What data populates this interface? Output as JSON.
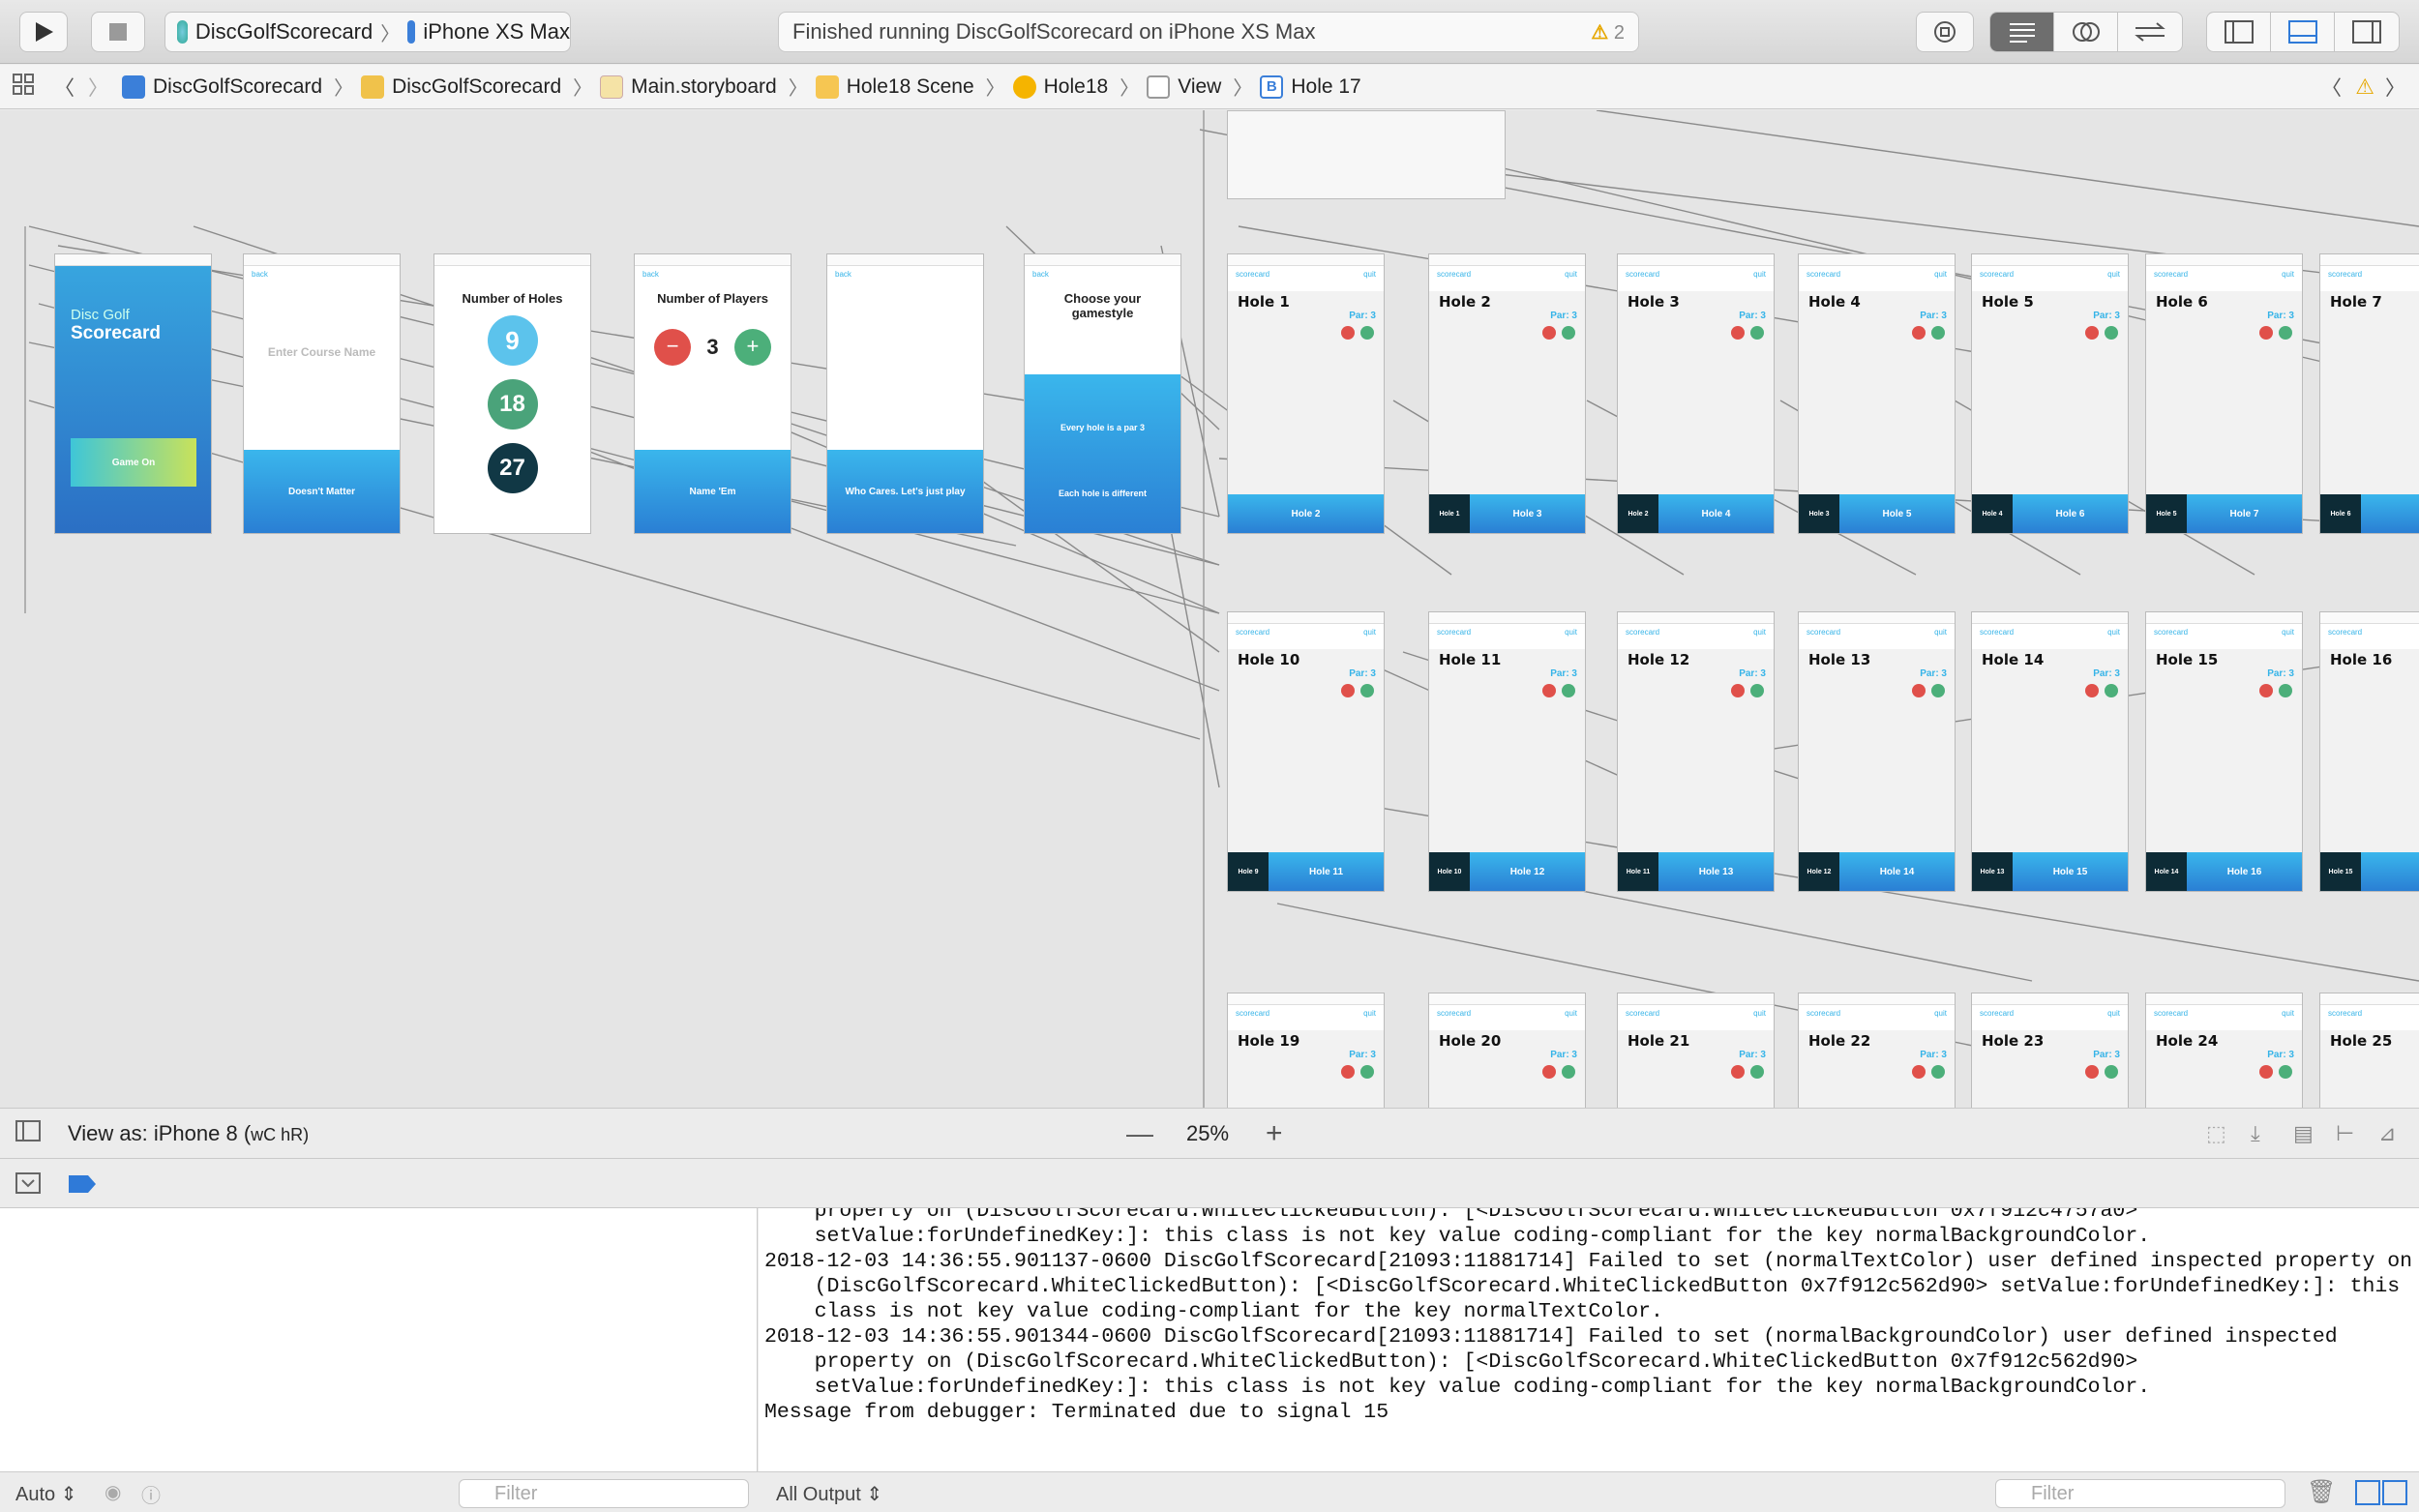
{
  "toolbar": {
    "scheme_target": "DiscGolfScorecard",
    "scheme_device": "iPhone XS Max",
    "activity_text": "Finished running DiscGolfScorecard on iPhone XS Max",
    "warning_count": "2"
  },
  "jumpbar": {
    "items": [
      "DiscGolfScorecard",
      "DiscGolfScorecard",
      "Main.storyboard",
      "Hole18 Scene",
      "Hole18",
      "View",
      "Hole 17"
    ]
  },
  "canvas": {
    "splash": {
      "title_top": "Disc Golf",
      "title_bottom": "Scorecard",
      "button": "Game On"
    },
    "course": {
      "placeholder": "Enter Course Name",
      "button": "Doesn't Matter"
    },
    "holes_scene": {
      "title": "Number of Holes",
      "options": [
        "9",
        "18",
        "27"
      ]
    },
    "players_scene": {
      "title": "Number of Players",
      "count": "3",
      "button": "Name 'Em"
    },
    "names_scene": {
      "button": "Who Cares. Let's just play"
    },
    "style_scene": {
      "title": "Choose your gamestyle",
      "option1": "Every hole is a par 3",
      "option2": "Each hole is different"
    },
    "hole_nav": {
      "back": "back",
      "scorecard": "scorecard",
      "quit": "quit",
      "par": "Par: 3"
    },
    "hole_titles": [
      "Hole 1",
      "Hole 2",
      "Hole 3",
      "Hole 4",
      "Hole 5",
      "Hole 6",
      "Hole 7",
      "Hole 10",
      "Hole 11",
      "Hole 12",
      "Hole 13",
      "Hole 14",
      "Hole 15",
      "Hole 16",
      "Hole 19",
      "Hole 20",
      "Hole 21",
      "Hole 22",
      "Hole 23",
      "Hole 24",
      "Hole 25"
    ],
    "row1_next": [
      "Hole 2",
      "Hole 3",
      "Hole 4",
      "Hole 5",
      "Hole 6",
      "Hole 7"
    ],
    "row1_prev": [
      "",
      "Hole 1",
      "Hole 2",
      "Hole 3",
      "Hole 4",
      "Hole 5",
      "Hole 6"
    ],
    "row2_next": [
      "Hole 11",
      "Hole 12",
      "Hole 13",
      "Hole 14",
      "Hole 15",
      "Hole 16"
    ],
    "row2_prev": [
      "Hole 9",
      "Hole 10",
      "Hole 11",
      "Hole 12",
      "Hole 13",
      "Hole 14",
      "Hole 15"
    ]
  },
  "canvasbar": {
    "view_as": "View as: iPhone 8 (",
    "size_class": "wC hR)",
    "zoom": "25%"
  },
  "console": {
    "lines": [
      "    property on (DiscGolfScorecard.WhiteClickedButton): [<DiscGolfScorecard.WhiteClickedButton 0x7f912c4757a0>",
      "    setValue:forUndefinedKey:]: this class is not key value coding-compliant for the key normalBackgroundColor.",
      "2018-12-03 14:36:55.901137-0600 DiscGolfScorecard[21093:11881714] Failed to set (normalTextColor) user defined inspected property on",
      "    (DiscGolfScorecard.WhiteClickedButton): [<DiscGolfScorecard.WhiteClickedButton 0x7f912c562d90> setValue:forUndefinedKey:]: this",
      "    class is not key value coding-compliant for the key normalTextColor.",
      "2018-12-03 14:36:55.901344-0600 DiscGolfScorecard[21093:11881714] Failed to set (normalBackgroundColor) user defined inspected",
      "    property on (DiscGolfScorecard.WhiteClickedButton): [<DiscGolfScorecard.WhiteClickedButton 0x7f912c562d90>",
      "    setValue:forUndefinedKey:]: this class is not key value coding-compliant for the key normalBackgroundColor.",
      "Message from debugger: Terminated due to signal 15"
    ]
  },
  "footer": {
    "auto": "Auto",
    "filter_left": "Filter",
    "output": "All Output",
    "filter_right": "Filter"
  },
  "colors": {
    "accent": "#2f7ad8",
    "warning": "#e6a700",
    "hole_blue": "#36b4e8",
    "minus_red": "#e0504a",
    "plus_green": "#4caf7a"
  }
}
